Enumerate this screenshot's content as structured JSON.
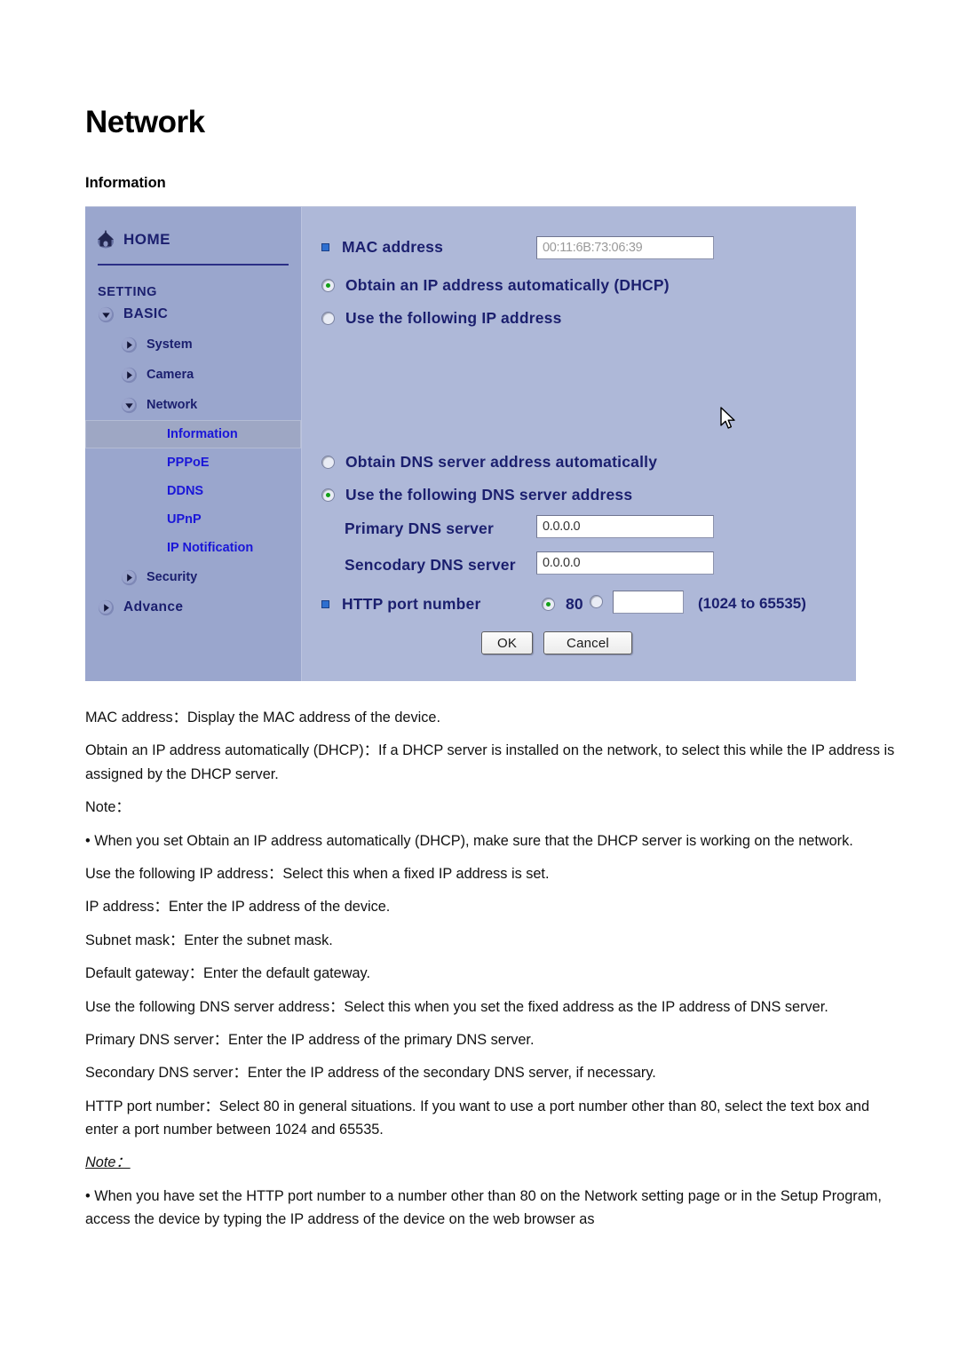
{
  "page": {
    "title": "Network",
    "section_label": "Information"
  },
  "device_ui": {
    "sidebar": {
      "home": {
        "label": "HOME",
        "icon": "home-icon"
      },
      "setting_label": "SETTING",
      "items": [
        {
          "label": "BASIC",
          "level": 1,
          "icon": "triangle-down-icon",
          "selected": false
        },
        {
          "label": "System",
          "level": 2,
          "icon": "triangle-right-icon",
          "selected": false
        },
        {
          "label": "Camera",
          "level": 2,
          "icon": "triangle-right-icon",
          "selected": false
        },
        {
          "label": "Network",
          "level": 2,
          "icon": "triangle-down-icon",
          "selected": false
        },
        {
          "label": "Information",
          "level": 3,
          "icon": "none",
          "selected": true
        },
        {
          "label": "PPPoE",
          "level": 3,
          "icon": "none",
          "selected": false
        },
        {
          "label": "DDNS",
          "level": 3,
          "icon": "none",
          "selected": false
        },
        {
          "label": "UPnP",
          "level": 3,
          "icon": "none",
          "selected": false
        },
        {
          "label": "IP Notification",
          "level": 3,
          "icon": "none",
          "selected": false
        },
        {
          "label": "Security",
          "level": 2,
          "icon": "triangle-right-icon",
          "selected": false
        },
        {
          "label": "Advance",
          "level": 1,
          "icon": "triangle-right-icon",
          "selected": false
        }
      ]
    },
    "form": {
      "mac_address_label": "MAC address",
      "mac_address_value": "00:11:6B:73:06:39",
      "dhcp_radio_label": "Obtain an IP address automatically (DHCP)",
      "static_ip_radio_label": "Use the following IP address",
      "dns_auto_radio_label": "Obtain DNS server address automatically",
      "dns_manual_radio_label": "Use the following DNS server address",
      "primary_dns_label": "Primary DNS server",
      "primary_dns_value": "0.0.0.0",
      "secondary_dns_label": "Sencodary DNS server",
      "secondary_dns_value": "0.0.0.0",
      "http_port_label": "HTTP port number",
      "http_port_default": "80",
      "http_port_custom_value": "",
      "http_port_range_hint": "(1024 to 65535)",
      "ok_button": "OK",
      "cancel_button": "Cancel"
    },
    "colors": {
      "sidebar_bg": "#9aa6cd",
      "main_bg": "#aeb8d8",
      "selected_bg": "#9ea7c4",
      "link_blue": "#1a16d8",
      "heading_navy": "#1b1f6e",
      "radio_dot_green": "#12a017",
      "square_bullet_blue": "#2e6fd0"
    }
  },
  "body_copy": {
    "paragraphs": [
      "MAC address：Display the MAC address of the device.",
      "Obtain an IP address automatically (DHCP)：If a DHCP server is installed on the network, to select this while the IP address is assigned by the DHCP server.",
      "Note：",
      "• When you set Obtain an IP address automatically (DHCP), make sure that the DHCP server is working on the network.",
      "Use the following IP address：Select this when a fixed IP address is set.",
      "IP address：Enter the IP address of the device.",
      "Subnet mask：Enter the subnet mask.",
      "Default gateway：Enter the default gateway.",
      "Use the following DNS server address：Select this when you set the fixed address as the IP address of DNS server.",
      "Primary DNS server：Enter the IP address of the primary DNS server.",
      "Secondary DNS server：Enter the IP address of the secondary DNS server, if necessary.",
      "HTTP port number：Select 80 in general situations. If you want to use a port number other than 80, select the text box and enter a port number between 1024 and 65535."
    ],
    "note_heading": "Note：",
    "note_paragraph": "• When you have set the HTTP port number to a number other than 80 on the Network setting page or in the Setup Program, access the device by typing the IP address of the device on the web browser as"
  }
}
